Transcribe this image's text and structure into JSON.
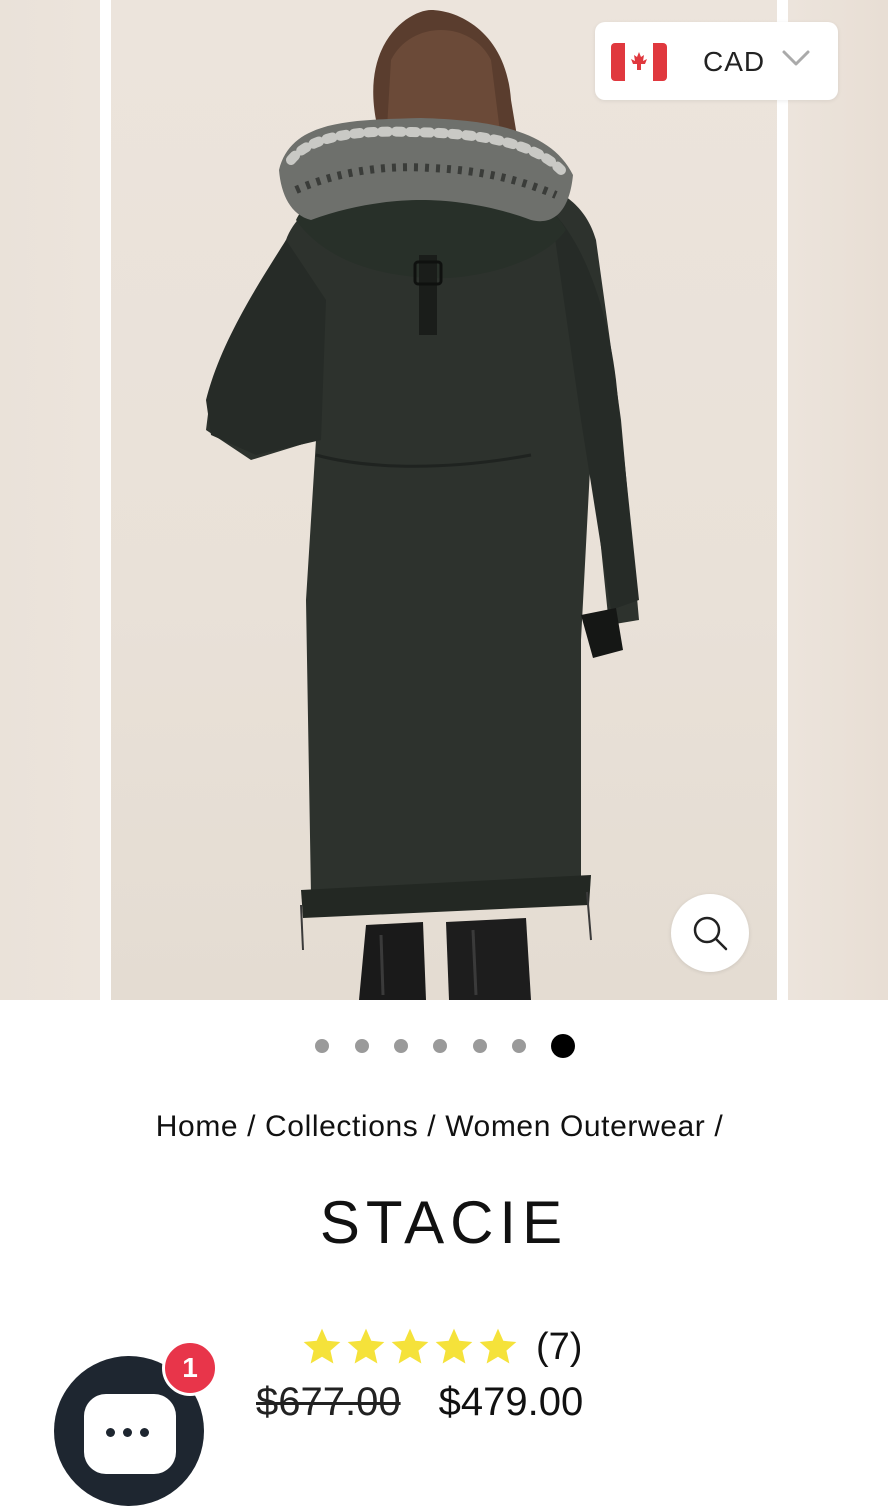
{
  "currency": {
    "code": "CAD",
    "flag_icon": "canada-flag-icon"
  },
  "gallery": {
    "active_index": 6,
    "total": 7
  },
  "breadcrumb": [
    {
      "label": "Home"
    },
    {
      "label": "Collections"
    },
    {
      "label": "Women Outerwear"
    }
  ],
  "breadcrumb_separator": " / ",
  "product": {
    "title": "STACIE",
    "rating_stars": 5,
    "review_count": "(7)",
    "original_price": "$677.00",
    "sale_price": "$479.00"
  },
  "chat": {
    "unread_count": "1"
  },
  "colors": {
    "star": "#f5e23a",
    "badge": "#e8354a",
    "chat": "#1e2630",
    "active_dot": "#000000",
    "inactive_dot": "#9a9a9a"
  }
}
